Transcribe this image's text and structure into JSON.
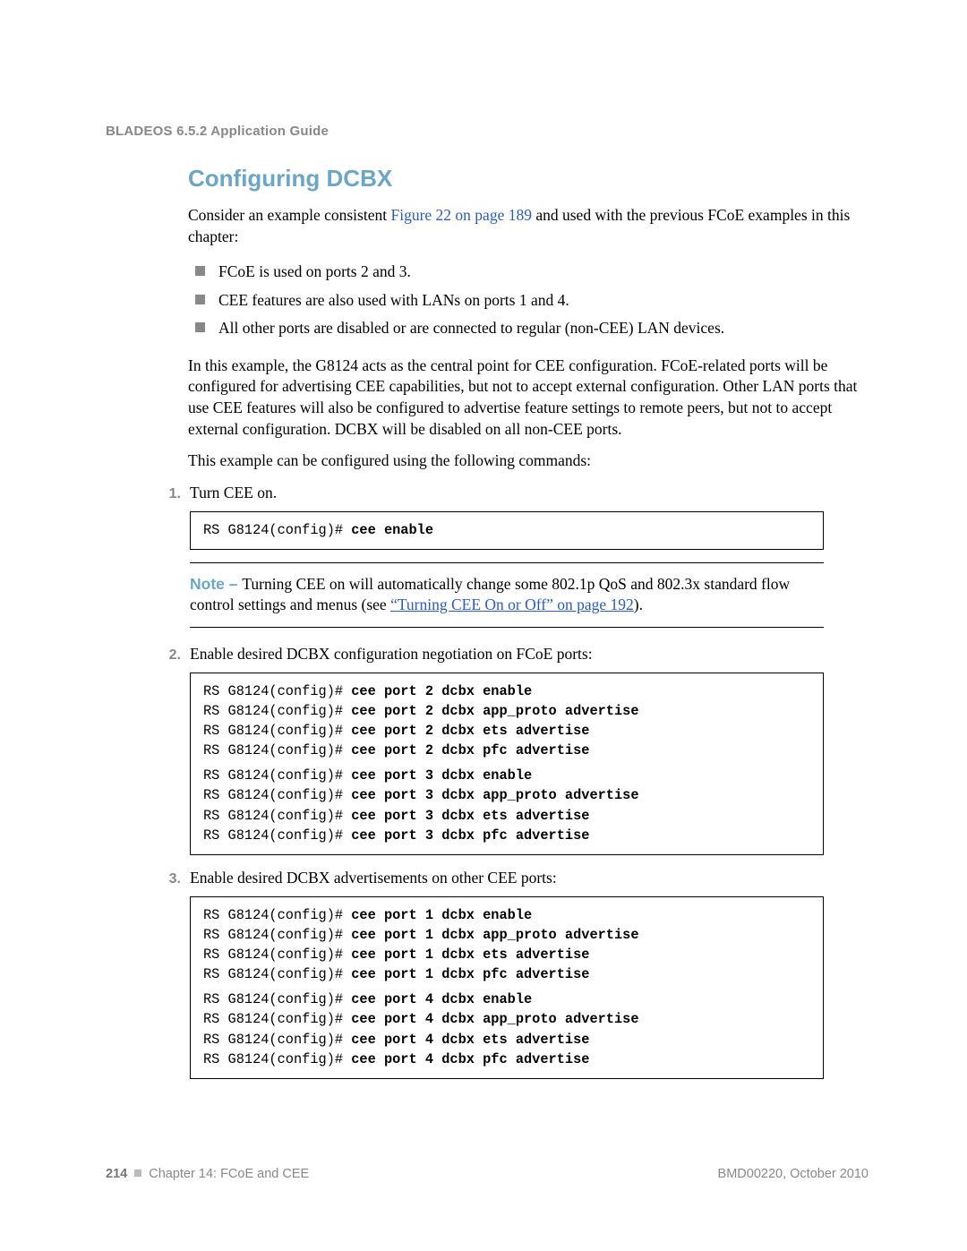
{
  "header": {
    "running": "BLADEOS 6.5.2 Application Guide"
  },
  "section": {
    "title": "Configuring DCBX",
    "intro_before_link": "Consider an example consistent ",
    "intro_link": "Figure 22 on page 189",
    "intro_after_link": " and used with the previous FCoE examples in this chapter:",
    "bullets": [
      "FCoE is used on ports 2 and 3.",
      "CEE features are also used with LANs on ports 1 and 4.",
      "All other ports are disabled or are connected to regular (non-CEE) LAN devices."
    ],
    "para2": "In this example, the G8124 acts as the central point for CEE configuration. FCoE-related ports will be configured for advertising CEE capabilities, but not to accept external configuration. Other LAN ports that use CEE features will also be configured to advertise feature settings to remote peers, but not to accept external configuration. DCBX will be disabled on all non-CEE ports.",
    "para3": "This example can be configured using the following commands:"
  },
  "steps": [
    {
      "num": "1.",
      "text": "Turn CEE on.",
      "code": [
        {
          "prompt": "RS G8124(config)# ",
          "cmd": "cee enable"
        }
      ],
      "note": {
        "label": "Note – ",
        "body_before": "Turning CEE on will automatically change some 802.1p QoS and 802.3x standard flow control settings and menus (see ",
        "link": "“Turning CEE On or Off” on page 192",
        "body_after": ")."
      }
    },
    {
      "num": "2.",
      "text": "Enable desired DCBX configuration negotiation on FCoE ports:",
      "code": [
        {
          "prompt": "RS G8124(config)# ",
          "cmd": "cee port 2 dcbx enable"
        },
        {
          "prompt": "RS G8124(config)# ",
          "cmd": "cee port 2 dcbx app_proto advertise"
        },
        {
          "prompt": "RS G8124(config)# ",
          "cmd": "cee port 2 dcbx ets advertise"
        },
        {
          "prompt": "RS G8124(config)# ",
          "cmd": "cee port 2 dcbx pfc advertise"
        },
        {
          "gap": true
        },
        {
          "prompt": "RS G8124(config)# ",
          "cmd": "cee port 3 dcbx enable"
        },
        {
          "prompt": "RS G8124(config)# ",
          "cmd": "cee port 3 dcbx app_proto advertise"
        },
        {
          "prompt": "RS G8124(config)# ",
          "cmd": "cee port 3 dcbx ets advertise"
        },
        {
          "prompt": "RS G8124(config)# ",
          "cmd": "cee port 3 dcbx pfc advertise"
        }
      ]
    },
    {
      "num": "3.",
      "text": "Enable desired DCBX advertisements on other CEE ports:",
      "code": [
        {
          "prompt": "RS G8124(config)# ",
          "cmd": "cee port 1 dcbx enable"
        },
        {
          "prompt": "RS G8124(config)# ",
          "cmd": "cee port 1 dcbx app_proto advertise"
        },
        {
          "prompt": "RS G8124(config)# ",
          "cmd": "cee port 1 dcbx ets advertise"
        },
        {
          "prompt": "RS G8124(config)# ",
          "cmd": "cee port 1 dcbx pfc advertise"
        },
        {
          "gap": true
        },
        {
          "prompt": "RS G8124(config)# ",
          "cmd": "cee port 4 dcbx enable"
        },
        {
          "prompt": "RS G8124(config)# ",
          "cmd": "cee port 4 dcbx app_proto advertise"
        },
        {
          "prompt": "RS G8124(config)# ",
          "cmd": "cee port 4 dcbx ets advertise"
        },
        {
          "prompt": "RS G8124(config)# ",
          "cmd": "cee port 4 dcbx pfc advertise"
        }
      ]
    }
  ],
  "footer": {
    "page_number": "214",
    "chapter": "Chapter 14: FCoE and CEE",
    "docid": "BMD00220, October 2010"
  }
}
